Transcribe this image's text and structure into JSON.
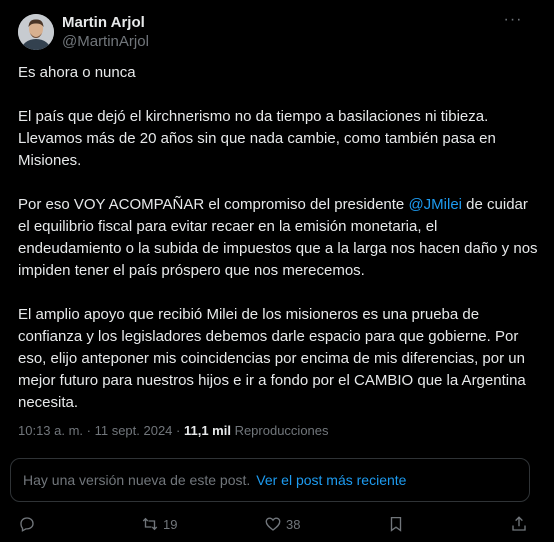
{
  "author": {
    "name": "Martin Arjol",
    "handle": "@MartinArjol"
  },
  "post": {
    "p1": "Es ahora o nunca",
    "p2": "El país que dejó el kirchnerismo no da tiempo a basilaciones ni tibieza. Llevamos más de 20 años sin que nada cambie, como también pasa en Misiones.",
    "p3_before": "Por eso VOY ACOMPAÑAR el compromiso del presidente ",
    "p3_mention": "@JMilei",
    "p3_after": " de cuidar el equilibrio fiscal para evitar recaer en la emisión monetaria, el endeudamiento o la subida de impuestos que a la larga nos hacen daño y nos impiden tener el país próspero que nos merecemos.",
    "p4": "El amplio apoyo que recibió Milei de los misioneros es una prueba de confianza y los legisladores debemos darle espacio para que gobierne. Por eso, elijo anteponer mis coincidencias por encima de mis diferencias, por un mejor futuro para nuestros hijos e ir a fondo por el CAMBIO que la Argentina necesita."
  },
  "meta": {
    "time": "10:13 a. m. · 11 sept. 2024 · ",
    "views": "11,1 mil",
    "views_label": " Reproducciones"
  },
  "notice": {
    "text": "Hay una versión nueva de este post.",
    "link": "Ver el post más reciente"
  },
  "actions": {
    "reposts": "19",
    "likes": "38",
    "icons": [
      "reply-icon",
      "repost-icon",
      "like-icon",
      "bookmark-icon",
      "share-icon"
    ]
  },
  "colors": {
    "background": "#000000",
    "text": "#e7e9ea",
    "secondary": "#71767b",
    "accent": "#1d9bf0",
    "border": "#2f3336"
  }
}
